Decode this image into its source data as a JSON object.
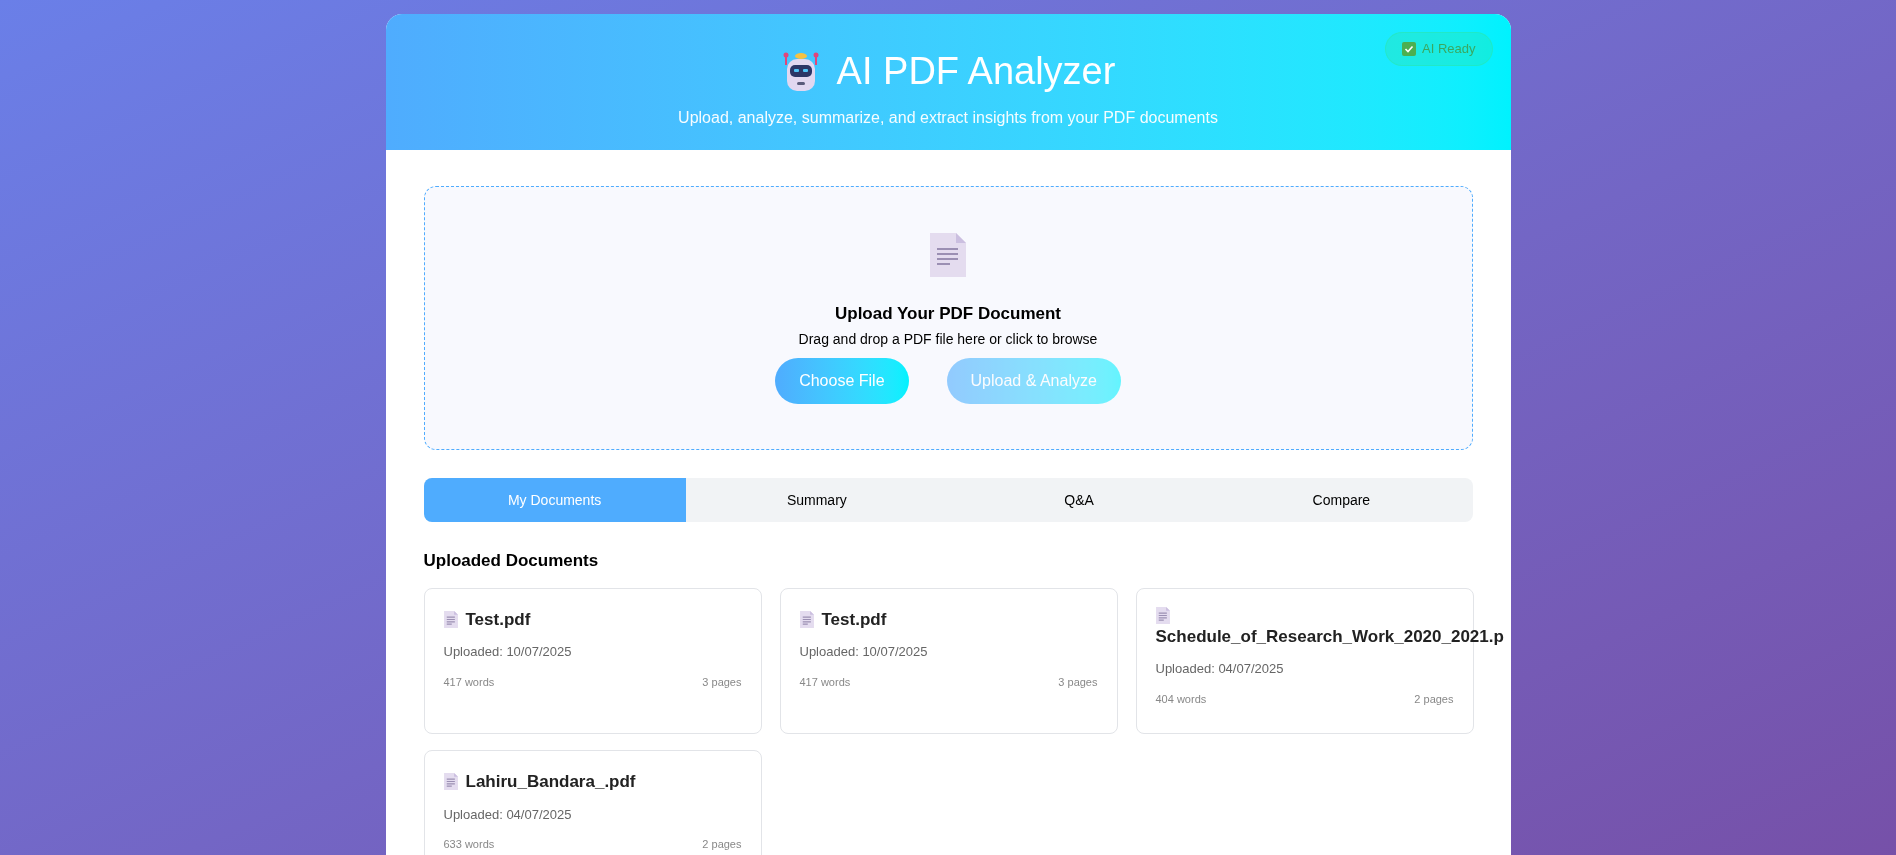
{
  "header": {
    "title": "AI PDF Analyzer",
    "subtitle": "Upload, analyze, summarize, and extract insights from your PDF documents",
    "status_badge": {
      "label": "AI Ready",
      "checked": true
    }
  },
  "upload": {
    "heading": "Upload Your PDF Document",
    "hint": "Drag and drop a PDF file here or click to browse",
    "buttons": [
      {
        "label": "Choose File",
        "disabled": false
      },
      {
        "label": "Upload & Analyze",
        "disabled": true
      }
    ]
  },
  "tabs": [
    {
      "label": "My Documents",
      "selected": true
    },
    {
      "label": "Summary",
      "selected": false
    },
    {
      "label": "Q&A",
      "selected": false
    },
    {
      "label": "Compare",
      "selected": false
    }
  ],
  "documents": {
    "heading": "Uploaded Documents",
    "items": [
      {
        "name": "Test.pdf",
        "uploaded": "Uploaded: 10/07/2025",
        "words": "417 words",
        "pages": "3 pages"
      },
      {
        "name": "Test.pdf",
        "uploaded": "Uploaded: 10/07/2025",
        "words": "417 words",
        "pages": "3 pages"
      },
      {
        "name": "Schedule_of_Research_Work_2020_2021.p",
        "uploaded": "Uploaded: 04/07/2025",
        "words": "404 words",
        "pages": "2 pages"
      },
      {
        "name": "Lahiru_Bandara_.pdf",
        "uploaded": "Uploaded: 04/07/2025",
        "words": "633 words",
        "pages": "2 pages"
      }
    ]
  }
}
